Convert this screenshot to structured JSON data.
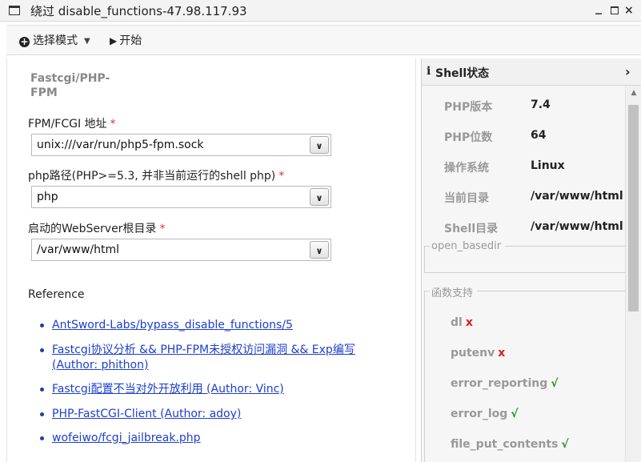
{
  "window": {
    "title": "绕过 disable_functions-47.98.117.93",
    "minimize": "_",
    "close": "×"
  },
  "toolbar": {
    "mode_label": "选择模式",
    "start_label": "开始"
  },
  "form": {
    "legend": "Fastcgi/PHP-FPM",
    "fields": [
      {
        "label": "FPM/FCGI 地址",
        "value": "unix:///var/run/php5-fpm.sock",
        "required": "*"
      },
      {
        "label": "php路径(PHP>=5.3, 并非当前运行的shell php)",
        "value": "php",
        "required": "*"
      },
      {
        "label": "启动的WebServer根目录",
        "value": "/var/www/html",
        "required": "*"
      }
    ]
  },
  "reference": {
    "title": "Reference",
    "links": [
      {
        "text": "AntSword-Labs/bypass_disable_functions/5"
      },
      {
        "text": "Fastcgi协议分析 && PHP-FPM未授权访问漏洞 && Exp编写 (Author: phithon)"
      },
      {
        "text": "Fastcgi配置不当对外开放利用 (Author: Vinc)"
      },
      {
        "text": "PHP-FastCGI-Client (Author: adoy)"
      },
      {
        "text": "wofeiwo/fcgi_jailbreak.php"
      }
    ]
  },
  "shell_status": {
    "title": "Shell状态",
    "info": [
      {
        "label": "PHP版本",
        "value": "7.4"
      },
      {
        "label": "PHP位数",
        "value": "64"
      },
      {
        "label": "操作系统",
        "value": "Linux"
      },
      {
        "label": "当前目录",
        "value": "/var/www/html"
      },
      {
        "label": "Shell目录",
        "value": "/var/www/html"
      }
    ],
    "open_basedir_label": "open_basedir",
    "functions_label": "函数支持",
    "functions": [
      {
        "name": "dl",
        "mark": "x",
        "status": "unsupported"
      },
      {
        "name": "putenv",
        "mark": "x",
        "status": "unsupported"
      },
      {
        "name": "error_reporting",
        "mark": "√",
        "status": "supported"
      },
      {
        "name": "error_log",
        "mark": "√",
        "status": "supported"
      },
      {
        "name": "file_put_contents",
        "mark": "√",
        "status": "supported"
      }
    ]
  }
}
